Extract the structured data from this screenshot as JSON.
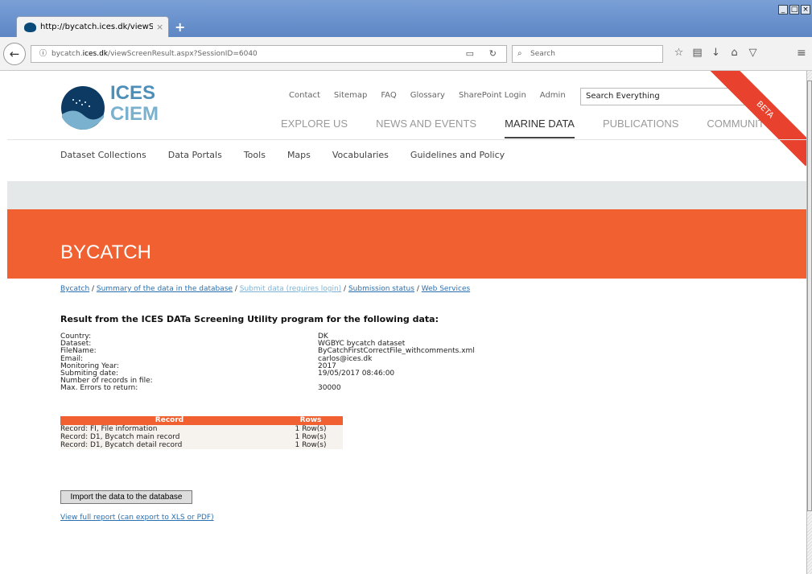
{
  "browser": {
    "tab_title": "http://bycatch.ices.dk/viewScre",
    "tab_close": "×",
    "new_tab": "+",
    "url_prefix": "bycatch.",
    "url_domain": "ices.dk",
    "url_path": "/viewScreenResult.aspx?SessionID=6040",
    "search_placeholder": "Search",
    "icons": [
      "back-icon",
      "info-icon",
      "reader-icon",
      "reload-icon",
      "search-icon",
      "bookmark-star-icon",
      "library-icon",
      "download-icon",
      "home-icon",
      "pocket-icon",
      "menu-icon"
    ]
  },
  "site": {
    "logo_line1": "ICES",
    "logo_line2": "CIEM",
    "top_links": [
      "Contact",
      "Sitemap",
      "FAQ",
      "Glossary",
      "SharePoint Login",
      "Admin"
    ],
    "search_value": "Search Everything",
    "main_nav": [
      {
        "label": "EXPLORE US",
        "active": false
      },
      {
        "label": "NEWS AND EVENTS",
        "active": false
      },
      {
        "label": "MARINE DATA",
        "active": true
      },
      {
        "label": "PUBLICATIONS",
        "active": false
      },
      {
        "label": "COMMUNITY",
        "active": false
      }
    ],
    "beta_label": "BETA",
    "sub_nav": [
      "Dataset Collections",
      "Data Portals",
      "Tools",
      "Maps",
      "Vocabularies",
      "Guidelines and Policy"
    ],
    "brand_color": "#f06030"
  },
  "page": {
    "title": "BYCATCH",
    "breadcrumb": [
      "Bycatch",
      "Summary of the data in the database",
      "Submit data (requires login)",
      "Submission status",
      "Web Services"
    ],
    "breadcrumb_sep": " / ",
    "heading": "Result from the ICES DATa Screening Utility program for the following data:",
    "info": [
      {
        "label": "Country:",
        "value": "DK"
      },
      {
        "label": "Dataset:",
        "value": "WGBYC bycatch dataset"
      },
      {
        "label": "FileName:",
        "value": "ByCatchFirstCorrectFile_withcomments.xml"
      },
      {
        "label": "Email:",
        "value": "carlos@ices.dk"
      },
      {
        "label": "Monitoring Year:",
        "value": "2017"
      },
      {
        "label": "Submiting date:",
        "value": "19/05/2017 08:46:00"
      },
      {
        "label": "Number of records in file:",
        "value": ""
      },
      {
        "label": "Max. Errors to return:",
        "value": "30000"
      }
    ],
    "table": {
      "headers": [
        "Record",
        "Rows"
      ],
      "rows": [
        [
          "Record: FI, File information",
          "1 Row(s)"
        ],
        [
          "Record: D1, Bycatch main record",
          "1 Row(s)"
        ],
        [
          "Record: D1, Bycatch detail record",
          "1 Row(s)"
        ]
      ]
    },
    "import_button": "Import the data to the database",
    "report_link": "View full report (can export to XLS or PDF)"
  }
}
